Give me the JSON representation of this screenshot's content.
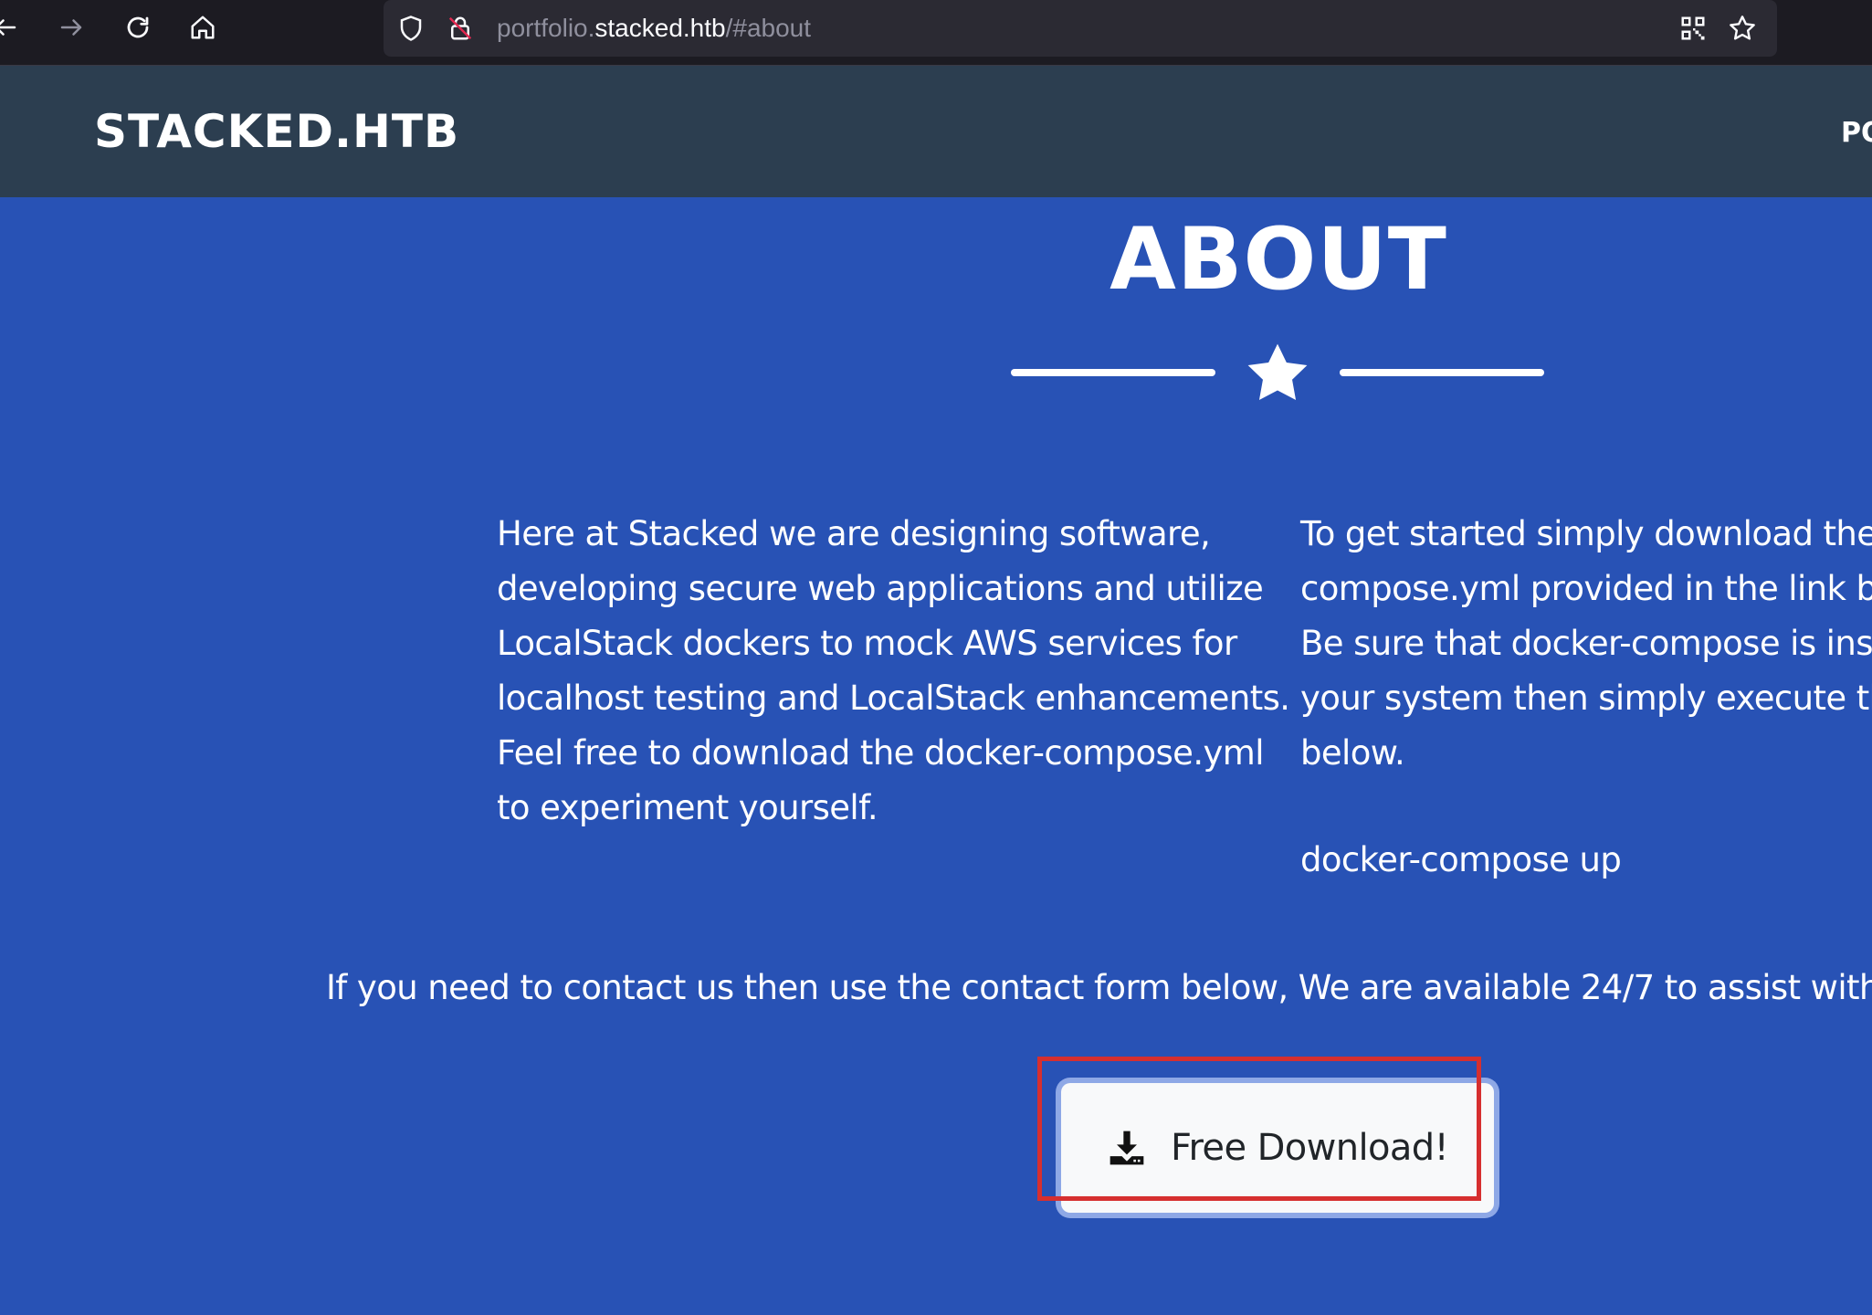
{
  "browser": {
    "url_prefix": "portfolio.",
    "url_domain": "stacked.htb",
    "url_suffix": "/#about"
  },
  "header": {
    "brand": "STACKED.HTB",
    "nav_portfolio": "PORTFOLIO"
  },
  "about": {
    "title": "ABOUT",
    "left_lines": [
      "Here at Stacked we are designing software,",
      "developing secure web applications and utilize",
      "LocalStack dockers to mock AWS services for",
      "localhost testing and LocalStack enhancements.",
      "Feel free to download the docker-compose.yml",
      "to experiment yourself."
    ],
    "right_lines": [
      "To get started simply download the d",
      "compose.yml provided in the link bel",
      "Be sure that docker-compose is insta",
      "your system then simply execute the",
      "below."
    ],
    "command": "docker-compose up",
    "contact_text": "If you need to contact us then use the contact form below, We are available 24/7 to assist with any",
    "download_label": "Free Download!"
  },
  "colors": {
    "section_bg": "#2852b5",
    "header_bg": "#2c3e50",
    "highlight": "#d62f2f"
  }
}
